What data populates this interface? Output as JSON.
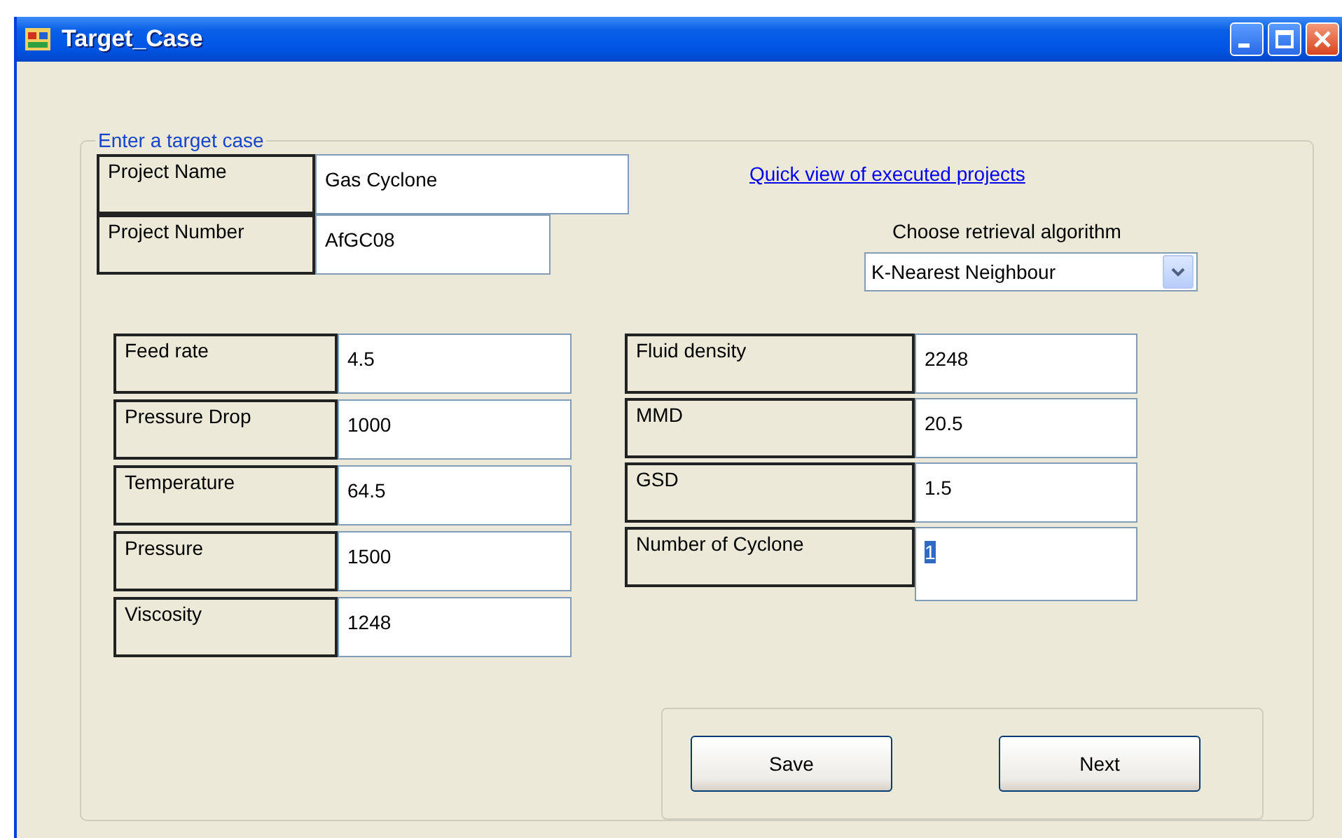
{
  "window": {
    "title": "Target_Case"
  },
  "group": {
    "title": "Enter a target case"
  },
  "project_fields": [
    {
      "label": "Project Name",
      "value": "Gas Cyclone",
      "highlighted": false
    },
    {
      "label": "Project Number",
      "value": "AfGC08",
      "highlighted": false
    }
  ],
  "link": "Quick view of executed projects",
  "algorithm": {
    "label": "Choose retrieval algorithm",
    "value": "K-Nearest Neighbour"
  },
  "left_fields": [
    {
      "label": "Feed rate",
      "value": "4.5",
      "highlighted": false
    },
    {
      "label": "Pressure Drop",
      "value": "1000",
      "highlighted": false
    },
    {
      "label": "Temperature",
      "value": "64.5",
      "highlighted": false
    },
    {
      "label": "Pressure",
      "value": "1500",
      "highlighted": false
    },
    {
      "label": "Viscosity",
      "value": "1248",
      "highlighted": false
    }
  ],
  "right_fields": [
    {
      "label": "Fluid density",
      "value": "2248",
      "highlighted": false
    },
    {
      "label": "MMD",
      "value": "20.5",
      "highlighted": false
    },
    {
      "label": "GSD",
      "value": "1.5",
      "highlighted": false
    },
    {
      "label": "Number of Cyclone",
      "value": "1",
      "highlighted": true
    }
  ],
  "buttons": [
    "Save",
    "Next"
  ]
}
